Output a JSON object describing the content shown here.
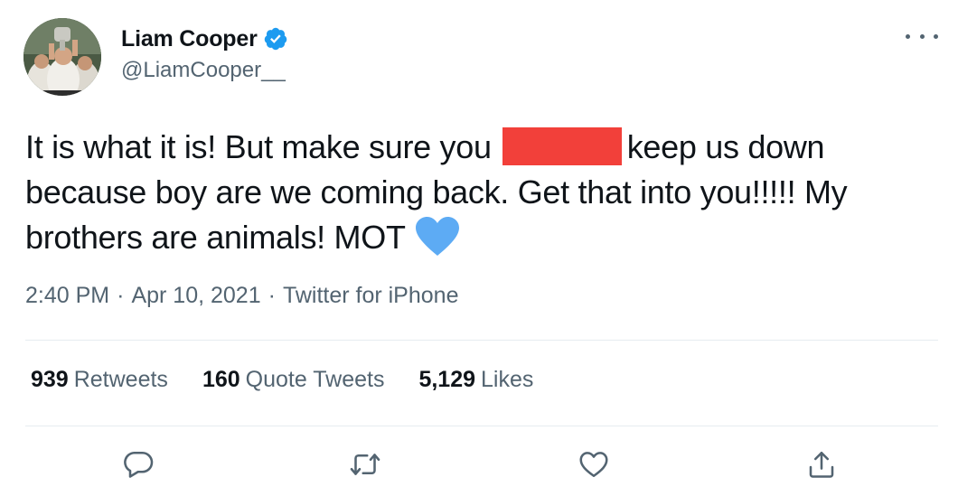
{
  "user": {
    "display_name": "Liam Cooper",
    "handle": "@LiamCooper__",
    "verified_icon": "verified-badge-icon",
    "avatar_icon": "avatar"
  },
  "tweet": {
    "text_part1": "It is what it is! But make sure you",
    "text_part2": "keep us down because boy are we coming back. Get that into you!!!!! My brothers are animals! MOT",
    "redaction_color": "#f2403a",
    "heart_color": "#5dabf4"
  },
  "meta": {
    "time": "2:40 PM",
    "separator": "·",
    "date": "Apr 10, 2021",
    "source": "Twitter for iPhone"
  },
  "stats": {
    "retweets_count": "939",
    "retweets_label": "Retweets",
    "quotes_count": "160",
    "quotes_label": "Quote Tweets",
    "likes_count": "5,129",
    "likes_label": "Likes"
  },
  "actions": [
    "reply-icon",
    "retweet-icon",
    "like-icon",
    "share-icon"
  ],
  "colors": {
    "text": "#0f1419",
    "secondary": "#536471",
    "verified": "#1d9bf0",
    "divider": "#e6ecf0"
  }
}
